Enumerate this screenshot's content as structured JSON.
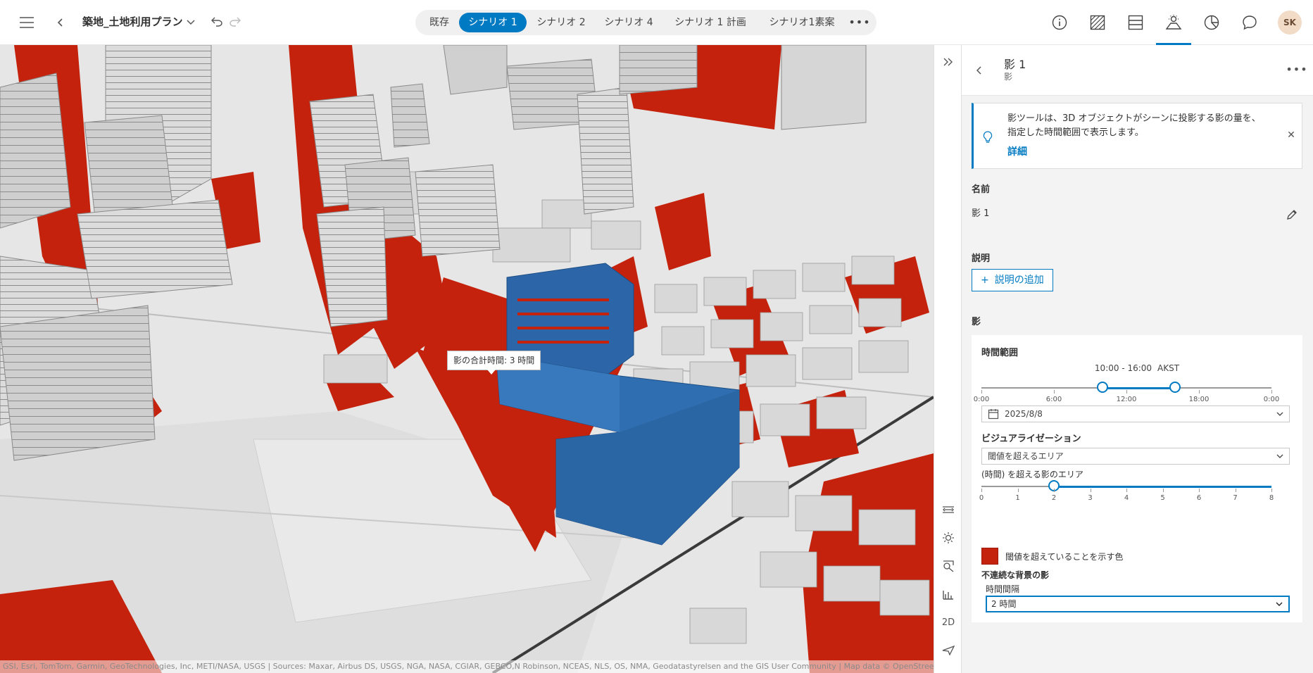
{
  "header": {
    "title": "築地_土地利用プラン",
    "scenarios": [
      "既存",
      "シナリオ 1",
      "シナリオ 2",
      "シナリオ 4",
      "シナリオ 1 計画",
      "シナリオ1素案"
    ],
    "active_scenario_index": 1,
    "avatar_initials": "SK",
    "tools": [
      "info-icon",
      "hatch-icon",
      "layers-icon",
      "shadow-analysis-icon",
      "chart-icon",
      "comment-icon"
    ],
    "active_tool": "shadow-analysis-icon"
  },
  "map": {
    "tooltip": "影の合計時間: 3 時間",
    "attribution": "GSI, Esri, TomTom, Garmin, GeoTechnologies, Inc, METI/NASA, USGS | Sources: Maxar, Airbus DS, USGS, NGA, NASA, CGIAR, GEBCO,N Robinson, NCEAS, NLS, OS, NMA, Geodatastyrelsen and the GIS User Community | Map data © OpenStreetMap",
    "view_mode_label": "2D",
    "colors": {
      "shadow": "#c4220c",
      "selected_building": "#2b6cb0",
      "building": "#d2d2d2"
    }
  },
  "panel": {
    "title": "影 1",
    "subtitle": "影",
    "notice_text": "影ツールは、3D オブジェクトがシーンに投影する影の量を、指定した時間範囲で表示します。",
    "notice_link": "詳細",
    "name_label": "名前",
    "name_value": "影 1",
    "description_label": "説明",
    "add_description": "説明の追加",
    "shadow_label": "影",
    "time_range_label": "時間範囲",
    "time_range_value": "10:00 - 16:00",
    "timezone": "AKST",
    "time_range_start_hour": 10,
    "time_range_end_hour": 16,
    "time_ticks": [
      "0:00",
      "6:00",
      "12:00",
      "18:00",
      "0:00"
    ],
    "date_value": "2025/8/8",
    "visualization_label": "ビジュアライゼーション",
    "visualization_value": "閾値を超えるエリア",
    "threshold_label": "(時間) を超える影のエリア",
    "threshold_value": 2,
    "threshold_ticks": [
      "0",
      "1",
      "2",
      "3",
      "4",
      "5",
      "6",
      "7",
      "8"
    ],
    "color_label": "閾値を超えていることを示す色",
    "threshold_color": "#c4220c",
    "discrete_label": "不連続な背景の影",
    "interval_label": "時間間隔",
    "interval_value": "2 時間",
    "accent_color": "#007ac2"
  }
}
